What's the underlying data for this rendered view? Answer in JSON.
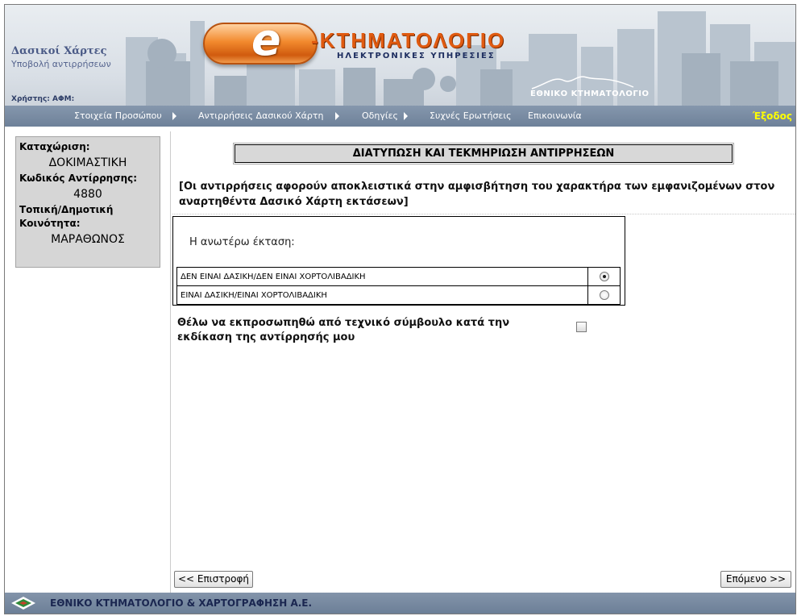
{
  "header": {
    "site_title": "Δασικοί Χάρτες",
    "site_subtitle": "Υποβολή αντιρρήσεων",
    "user_label": "Χρήστης: ΑΦΜ:",
    "logo_letter": "e",
    "logo_title": "-ΚΤΗΜΑΤΟΛΟΓΙΟ",
    "logo_tagline": "ΗΛΕΚΤΡΟΝΙΚΕΣ ΥΠΗΡΕΣΙΕΣ",
    "org_logo_text": "ΕΘΝΙΚΟ ΚΤΗΜΑΤΟΛΟΓΙΟ"
  },
  "nav": {
    "items": [
      {
        "label": "Στοιχεία Προσώπου",
        "has_submenu": true
      },
      {
        "label": "Αντιρρήσεις Δασικού Χάρτη",
        "has_submenu": true
      },
      {
        "label": "Οδηγίες",
        "has_submenu": true
      },
      {
        "label": "Συχνές Ερωτήσεις",
        "has_submenu": false
      },
      {
        "label": "Επικοινωνία",
        "has_submenu": false
      }
    ],
    "exit_label": "Έξοδος"
  },
  "sidebar": {
    "registration_label": "Καταχώριση:",
    "registration_value": "ΔΟΚΙΜΑΣΤΙΚΗ",
    "objection_code_label": "Κωδικός Αντίρρησης:",
    "objection_code_value": "4880",
    "community_label": "Τοπική/Δημοτική Κοινότητα:",
    "community_value": "ΜΑΡΑΘΩΝΟΣ"
  },
  "main": {
    "section_title": "ΔΙΑΤΥΠΩΣΗ ΚΑΙ ΤΕΚΜΗΡΙΩΣΗ ΑΝΤΙΡΡΗΣΕΩΝ",
    "notice": "[Οι αντιρρήσεις αφορούν αποκλειστικά στην αμφισβήτηση του χαρακτήρα των εμφανιζομένων στον αναρτηθέντα Δασικό Χάρτη εκτάσεων]",
    "question": "Η ανωτέρω έκταση:",
    "options": [
      {
        "label": "ΔΕΝ ΕΙΝΑΙ ΔΑΣΙΚΗ/ΔΕΝ ΕΙΝΑΙ ΧΟΡΤΟΛΙΒΑΔΙΚΗ",
        "selected": true
      },
      {
        "label": "ΕΙΝΑΙ ΔΑΣΙΚΗ/ΕΙΝΑΙ ΧΟΡΤΟΛΙΒΑΔΙΚΗ",
        "selected": false
      }
    ],
    "advisor_text": "Θέλω να εκπροσωπηθώ από τεχνικό σύμβουλο κατά την εκδίκαση της αντίρρησής μου",
    "advisor_checked": false,
    "back_label": "<< Επιστροφή",
    "next_label": "Επόμενο >>"
  },
  "footer": {
    "text": "ΕΘΝΙΚΟ ΚΤΗΜΑΤΟΛΟΓΙΟ & ΧΑΡΤΟΓΡΑΦΗΣΗ Α.Ε."
  },
  "colors": {
    "nav_bg": "#6e8199",
    "exit_link": "#ffff00",
    "logo_orange": "#e05a10",
    "sidebar_bg": "#d6d6d6"
  }
}
